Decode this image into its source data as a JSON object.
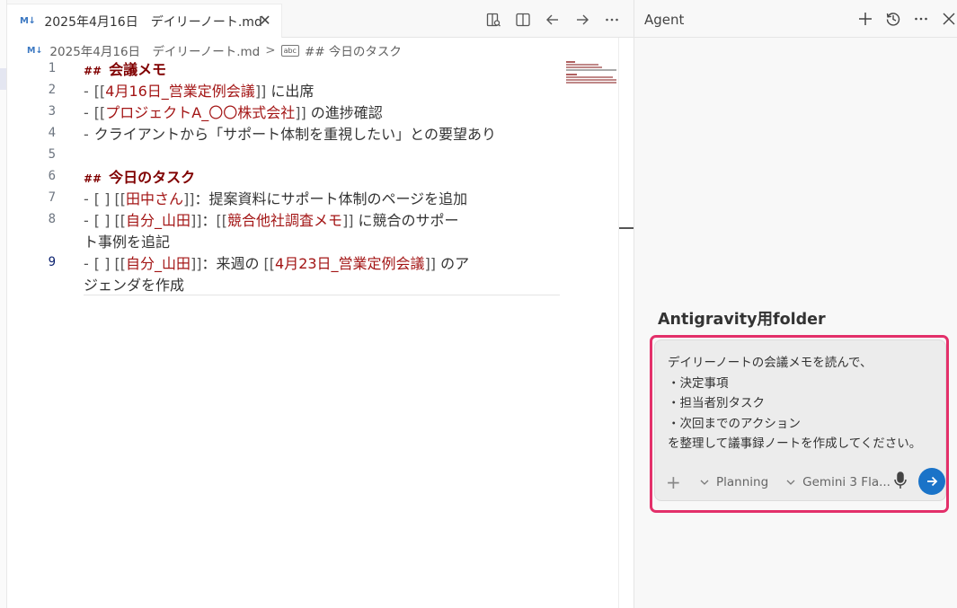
{
  "editor": {
    "tab": {
      "icon": "markdown-icon",
      "icon_text": "M↓",
      "label": "2025年4月16日　デイリーノート.md",
      "close": "✕"
    },
    "breadcrumb": {
      "file_icon_text": "M↓",
      "file": "2025年4月16日　デイリーノート.md",
      "separator": ">",
      "symbol_icon_text": "abc",
      "symbol": "## 今日のタスク"
    },
    "actions": [
      "open-preview-icon",
      "split-editor-icon",
      "go-back-icon",
      "go-forward-icon",
      "more-actions-icon"
    ],
    "line_numbers": [
      "1",
      "2",
      "3",
      "4",
      "5",
      "6",
      "7",
      "8",
      "",
      "9",
      ""
    ],
    "active_line": "9",
    "lines": {
      "l1": {
        "hash": "##",
        "text": "会議メモ"
      },
      "l2": {
        "dash": "-",
        "open": "[[",
        "link": "4月16日_営業定例会議",
        "close": "]]",
        "after": " に出席"
      },
      "l3": {
        "dash": "-",
        "open": "[[",
        "link": "プロジェクトA_〇〇株式会社",
        "close": "]]",
        "after": " の進捗確認"
      },
      "l4": {
        "dash": "-",
        "text": "クライアントから「サポート体制を重視したい」との要望あり"
      },
      "l6": {
        "hash": "##",
        "text": "今日のタスク"
      },
      "l7": {
        "dash": "-",
        "box": "[ ]",
        "open": "[[",
        "link": "田中さん",
        "close": "]]",
        "after": "：提案資料にサポート体制のページを追加"
      },
      "l8": {
        "dash": "-",
        "box": "[ ]",
        "open": "[[",
        "link": "自分_山田",
        "close": "]]",
        "mid": "：",
        "open2": "[[",
        "link2": "競合他社調査メモ",
        "close2": "]]",
        "after": " に競合のサポー",
        "wrap": "ト事例を追記"
      },
      "l9": {
        "dash": "-",
        "box": "[ ]",
        "open": "[[",
        "link": "自分_山田",
        "close": "]]",
        "mid": "：来週の ",
        "open2": "[[",
        "link2": "4月23日_営業定例会議",
        "close2": "]]",
        "after": " のア",
        "wrap": "ジェンダを作成"
      }
    }
  },
  "agent": {
    "title": "Agent",
    "actions": [
      "new-chat-icon",
      "history-icon",
      "more-icon",
      "close-icon"
    ],
    "workspace_title": "Antigravity用folder",
    "input_text": "デイリーノートの会議メモを読んで、\n・決定事項\n・担当者別タスク\n・次回までのアクション\nを整理して議事録ノートを作成してください。",
    "tools": {
      "add": "+",
      "mode": "Planning",
      "model": "Gemini 3 Fla..."
    }
  },
  "colors": {
    "heading": "#800000",
    "link": "#a31515",
    "highlight": "#e3306a",
    "send_button": "#1a73c8"
  }
}
